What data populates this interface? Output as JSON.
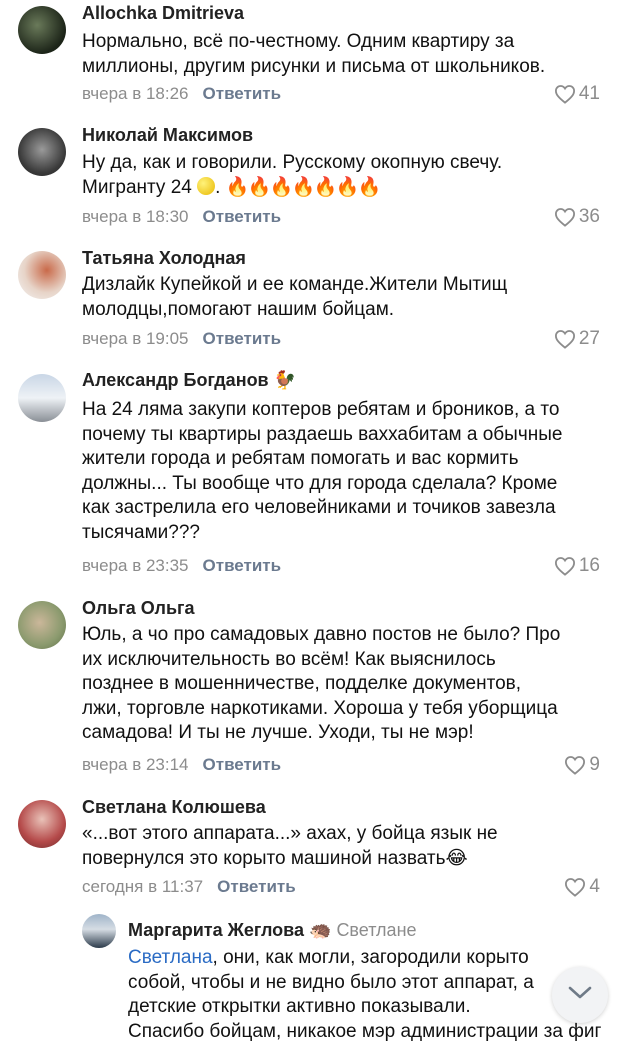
{
  "colors": {
    "accent": "#2a6bc4",
    "muted": "#8c8c8c",
    "action": "#6b7a8f"
  },
  "reply_label": "Ответить",
  "comments": [
    {
      "author": "Allochka Dmitrieva",
      "lines": [
        "Нормально, всё по-честному. Одним квартиру за",
        "миллионы, другим рисунки и письма от школьников."
      ],
      "time": "вчера в 18:26",
      "likes": "41"
    },
    {
      "author": "Николай Максимов",
      "lines": [
        "Ну да, как и говорили. Русскому окопную свечу.",
        "Мигранту 24"
      ],
      "time": "вчера в 18:30",
      "likes": "36",
      "emojis": [
        "lemon",
        "fire",
        "fire",
        "fire",
        "fire",
        "fire",
        "fire",
        "fire"
      ]
    },
    {
      "author": "Татьяна Холодная",
      "lines": [
        "Дизлайк Купейкой и ее команде.Жители Мытищ",
        "молодцы,помогают нашим бойцам."
      ],
      "time": "вчера в 19:05",
      "likes": "27"
    },
    {
      "author": "Александр Богданов",
      "author_emoji": "rooster",
      "lines": [
        "На 24 ляма закупи коптеров ребятам и броников, а то",
        "почему ты квартиры раздаешь ваххабитам а обычные",
        "жители города и ребятам помогать и вас кормить",
        "должны... Ты вообще что для города сделала? Кроме",
        "как застрелила его человейниками и точиков завезла",
        "тысячами???"
      ],
      "time": "вчера в 23:35",
      "likes": "16"
    },
    {
      "author": "Ольга Ольга",
      "lines": [
        "Юль, а чо про самадовых давно постов не было? Про",
        "их исключительность во всём! Как выяснилось",
        "позднее  в мошенничестве,  подделке документов,",
        "лжи, торговле наркотиками. Хороша у тебя уборщица",
        "самадова! И ты не лучше.  Уходи,  ты не мэр!"
      ],
      "time": "вчера в 23:14",
      "likes": "9"
    },
    {
      "author": "Светлана Колюшева",
      "lines": [
        "«...вот этого аппарата...» ахах, у бойца язык не",
        "повернулся это корыто машиной назвать"
      ],
      "time": "сегодня в 11:37",
      "likes": "4",
      "emojis": [
        "laugh"
      ]
    }
  ],
  "reply": {
    "author": "Маргарита Жеглова",
    "author_emoji": "hedgehog",
    "to": "Светлане",
    "mention": "Светлана",
    "lines": [
      ", они, как могли, загородили корыто",
      "собой, чтобы и не видно было этот аппарат, а",
      "детские открытки активно показывали.",
      "Спасибо бойцам, никакое мэр администрации за фиг"
    ]
  },
  "icons": {
    "heart": "heart-outline-icon",
    "scroll": "chevron-down-icon"
  }
}
